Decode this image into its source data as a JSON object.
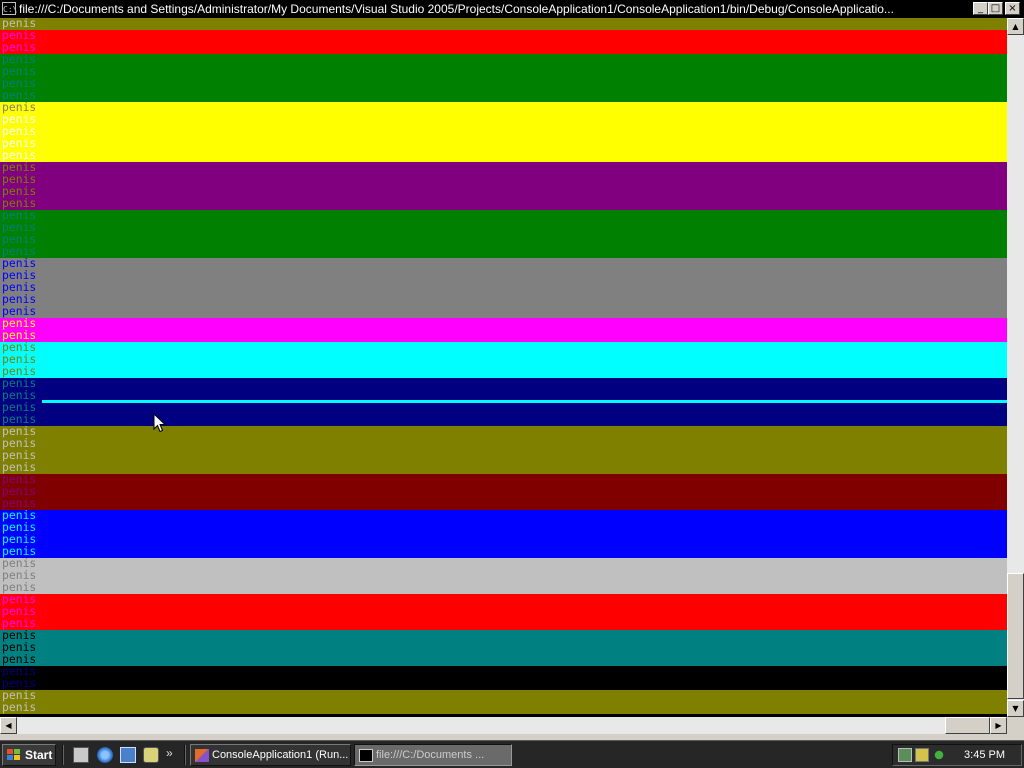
{
  "window": {
    "title": "file:///C:/Documents and Settings/Administrator/My Documents/Visual Studio 2005/Projects/ConsoleApplication1/ConsoleApplication1/bin/Debug/ConsoleApplicatio...",
    "icon": "console-icon",
    "icon_text": "C:\\",
    "buttons": {
      "minimize": "_",
      "maximize": "□",
      "close": "×"
    }
  },
  "console": {
    "text": "penis",
    "rows": [
      {
        "bg": "#808000",
        "fg": "#c0c0c0"
      },
      {
        "bg": "#ff0000",
        "fg": "#ff00ff"
      },
      {
        "bg": "#ff0000",
        "fg": "#ff00ff"
      },
      {
        "bg": "#008000",
        "fg": "#008080"
      },
      {
        "bg": "#008000",
        "fg": "#008080"
      },
      {
        "bg": "#008000",
        "fg": "#008080"
      },
      {
        "bg": "#008000",
        "fg": "#008080"
      },
      {
        "bg": "#ffff00",
        "fg": "#808080"
      },
      {
        "bg": "#ffff00",
        "fg": "#ffffff"
      },
      {
        "bg": "#ffff00",
        "fg": "#ffffff"
      },
      {
        "bg": "#ffff00",
        "fg": "#ffffff"
      },
      {
        "bg": "#ffff00",
        "fg": "#ffffff"
      },
      {
        "bg": "#800080",
        "fg": "#808000"
      },
      {
        "bg": "#800080",
        "fg": "#808000"
      },
      {
        "bg": "#800080",
        "fg": "#808000"
      },
      {
        "bg": "#800080",
        "fg": "#808000"
      },
      {
        "bg": "#008000",
        "fg": "#008080"
      },
      {
        "bg": "#008000",
        "fg": "#008080"
      },
      {
        "bg": "#008000",
        "fg": "#008080"
      },
      {
        "bg": "#008000",
        "fg": "#008080"
      },
      {
        "bg": "#808080",
        "fg": "#0000ff"
      },
      {
        "bg": "#808080",
        "fg": "#0000ff"
      },
      {
        "bg": "#808080",
        "fg": "#0000ff"
      },
      {
        "bg": "#808080",
        "fg": "#0000ff"
      },
      {
        "bg": "#808080",
        "fg": "#0000ff"
      },
      {
        "bg": "#ff00ff",
        "fg": "#ffff00"
      },
      {
        "bg": "#ff00ff",
        "fg": "#ffff00"
      },
      {
        "bg": "#00ffff",
        "fg": "#808000"
      },
      {
        "bg": "#00ffff",
        "fg": "#808000"
      },
      {
        "bg": "#00ffff",
        "fg": "#808000"
      },
      {
        "bg": "#000080",
        "fg": "#008080"
      },
      {
        "bg": "#000080",
        "fg": "#008080"
      },
      {
        "bg": "#000080",
        "fg": "#008080"
      },
      {
        "bg": "#000080",
        "fg": "#008080"
      },
      {
        "bg": "#808000",
        "fg": "#c0c0c0"
      },
      {
        "bg": "#808000",
        "fg": "#c0c0c0"
      },
      {
        "bg": "#808000",
        "fg": "#c0c0c0"
      },
      {
        "bg": "#808000",
        "fg": "#c0c0c0"
      },
      {
        "bg": "#800000",
        "fg": "#800080"
      },
      {
        "bg": "#800000",
        "fg": "#800080"
      },
      {
        "bg": "#800000",
        "fg": "#800080"
      },
      {
        "bg": "#0000ff",
        "fg": "#00ffff"
      },
      {
        "bg": "#0000ff",
        "fg": "#00ffff"
      },
      {
        "bg": "#0000ff",
        "fg": "#00ffff"
      },
      {
        "bg": "#0000ff",
        "fg": "#00ffff"
      },
      {
        "bg": "#c0c0c0",
        "fg": "#808080"
      },
      {
        "bg": "#c0c0c0",
        "fg": "#808080"
      },
      {
        "bg": "#c0c0c0",
        "fg": "#808080"
      },
      {
        "bg": "#ff0000",
        "fg": "#ff00ff"
      },
      {
        "bg": "#ff0000",
        "fg": "#ff00ff"
      },
      {
        "bg": "#ff0000",
        "fg": "#ff00ff"
      },
      {
        "bg": "#008080",
        "fg": "#000000"
      },
      {
        "bg": "#008080",
        "fg": "#000000"
      },
      {
        "bg": "#008080",
        "fg": "#000000"
      },
      {
        "bg": "#000000",
        "fg": "#000080"
      },
      {
        "bg": "#000000",
        "fg": "#000080"
      },
      {
        "bg": "#808000",
        "fg": "#c0c0c0"
      },
      {
        "bg": "#808000",
        "fg": "#c0c0c0"
      }
    ],
    "highlight_line": {
      "color": "#00ffff"
    }
  },
  "scrollbars": {
    "vertical": {
      "up_arrow": "▲",
      "down_arrow": "▼",
      "position": 0.97
    },
    "horizontal": {
      "left_arrow": "◀",
      "right_arrow": "▶",
      "position": 0.98
    }
  },
  "taskbar": {
    "start_label": "Start",
    "start_icon": "windows-flag-icon",
    "quick_launch": [
      {
        "name": "desktop-icon"
      },
      {
        "name": "internet-explorer-icon"
      },
      {
        "name": "outlook-express-icon"
      },
      {
        "name": "search-icon"
      }
    ],
    "more": "»",
    "tasks": [
      {
        "label": "ConsoleApplication1 (Run...",
        "icon": "visual-studio-icon",
        "active": false
      },
      {
        "label": "file:///C:/Documents ...",
        "icon": "console-icon",
        "active": true
      }
    ],
    "tray_icons": [
      "network-icon",
      "security-icon",
      "messenger-icon"
    ],
    "clock": "3:45 PM"
  }
}
